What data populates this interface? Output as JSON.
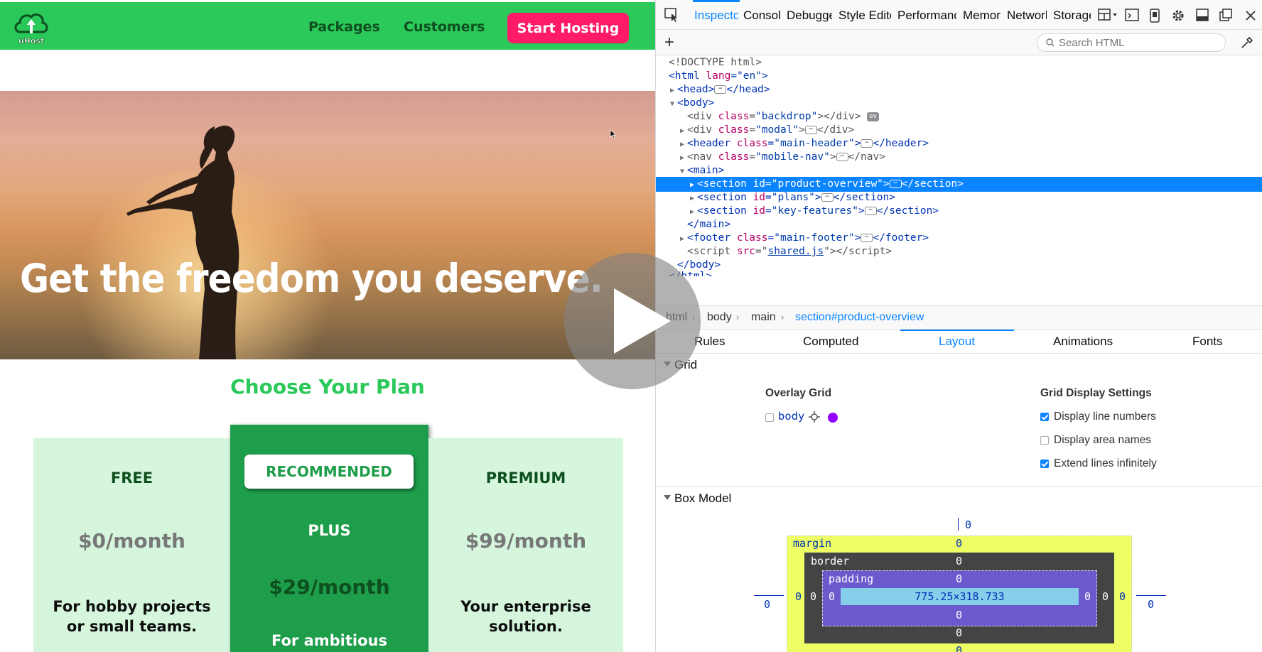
{
  "site": {
    "nav": {
      "packages": "Packages",
      "customers": "Customers",
      "cta": "Start Hosting"
    },
    "logo_text": "uHost",
    "hero_title": "Get the freedom you deserve.",
    "plans_title": "Choose Your Plan",
    "plans": [
      {
        "name": "FREE",
        "price": "$0/month",
        "desc1": "For hobby projects",
        "desc2": "or small teams."
      },
      {
        "badge": "RECOMMENDED",
        "name": "PLUS",
        "price": "$29/month",
        "desc1": "For ambitious"
      },
      {
        "name": "PREMIUM",
        "price": "$99/month",
        "desc1": "Your enterprise",
        "desc2": "solution."
      }
    ],
    "colors": {
      "header": "#2bc85a",
      "cta": "#ff1b68",
      "plan_bg": "#d5f6dd",
      "recommended_bg": "#1e9d4a"
    }
  },
  "video_overlay": {
    "icon": "play-icon"
  },
  "devtools": {
    "tabs": [
      "Inspector",
      "Console",
      "Debugger",
      "Style Editor",
      "Performance",
      "Memory",
      "Network",
      "Storage"
    ],
    "active_tab": "Inspector",
    "search_placeholder": "Search HTML",
    "markup": {
      "doctype": "<!DOCTYPE html>",
      "html_open": "html",
      "html_lang_attr": "lang",
      "html_lang_val": "\"en\"",
      "head": "head",
      "body": "body",
      "backdrop_class": "\"backdrop\"",
      "modal_class": "\"modal\"",
      "header_class": "\"main-header\"",
      "mobile_nav_class": "\"mobile-nav\"",
      "main": "main",
      "section1_id": "\"product-overview\"",
      "section2_id": "\"plans\"",
      "section3_id": "\"key-features\"",
      "footer_class": "\"main-footer\"",
      "script_src": "shared.js",
      "ev_badge": "ev",
      "html_close": "</html>"
    },
    "breadcrumbs": [
      "html",
      "body",
      "main",
      "section#product-overview"
    ],
    "side_tabs": [
      "Rules",
      "Computed",
      "Layout",
      "Animations",
      "Fonts"
    ],
    "active_side_tab": "Layout",
    "grid": {
      "section_label": "Grid",
      "overlay_heading": "Overlay Grid",
      "overlay_item": "body",
      "overlay_color": "#9400ff",
      "display_heading": "Grid Display Settings",
      "options": [
        {
          "label": "Display line numbers",
          "checked": true
        },
        {
          "label": "Display area names",
          "checked": false
        },
        {
          "label": "Extend lines infinitely",
          "checked": true
        }
      ]
    },
    "box_model": {
      "section_label": "Box Model",
      "position_top": "0",
      "margin_label": "margin",
      "margin_top": "0",
      "margin_left": "0",
      "margin_right": "0",
      "margin_bottom": "0",
      "border_label": "border",
      "border_top": "0",
      "border_left": "0",
      "border_right": "0",
      "border_bottom": "0",
      "padding_label": "padding",
      "padding_top": "0",
      "padding_left": "0",
      "padding_right": "0",
      "padding_bottom": "0",
      "content_size": "775.25×318.733",
      "outer_left": "0",
      "outer_right": "0"
    }
  }
}
